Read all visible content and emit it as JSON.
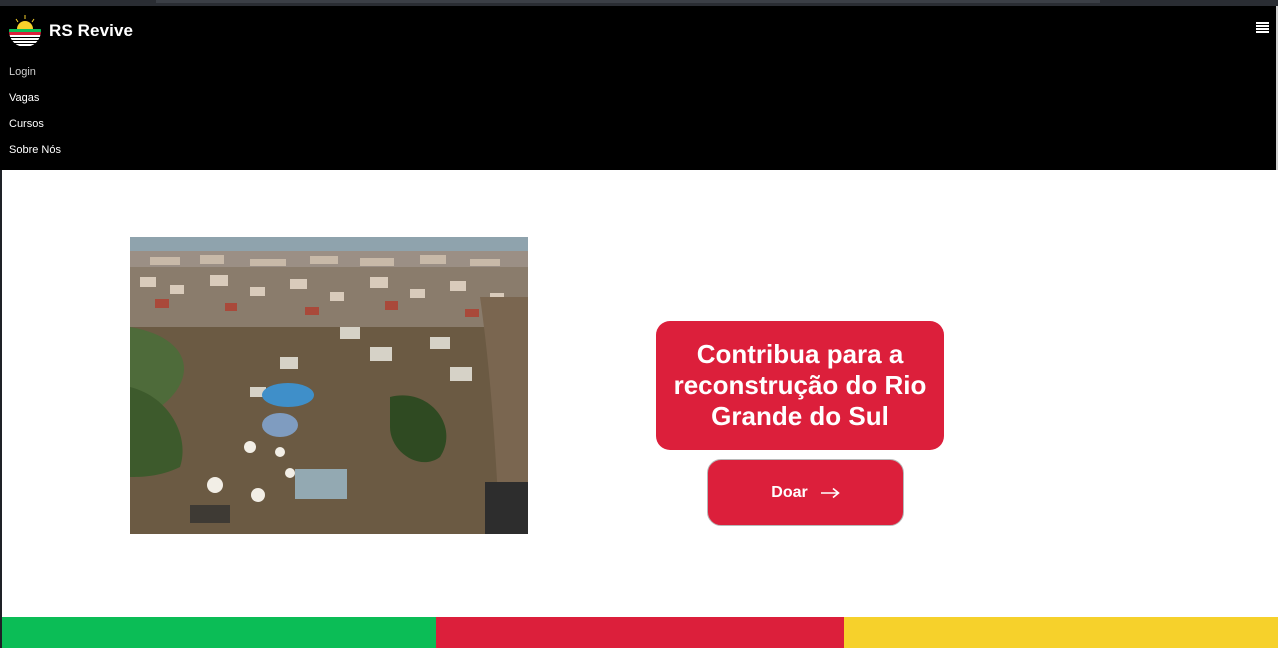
{
  "brand": {
    "name": "RS Revive",
    "logo_icon": "sun-waves-logo"
  },
  "nav": {
    "menu_icon": "hamburger-menu-icon",
    "links": [
      "Login",
      "Vagas",
      "Cursos",
      "Sobre Nós"
    ]
  },
  "hero": {
    "image_icon": "flooded-city-aerial-photo",
    "cta_title": "Contribua para a reconstrução do Rio Grande do Sul",
    "donate_label": "Doar",
    "donate_icon": "arrow-right-icon"
  },
  "colors": {
    "navbar_bg": "#000000",
    "accent_red": "#dc1f3b",
    "stripe_green": "#0bbd56",
    "stripe_red": "#dc1f3b",
    "stripe_yellow": "#f6d12b"
  }
}
